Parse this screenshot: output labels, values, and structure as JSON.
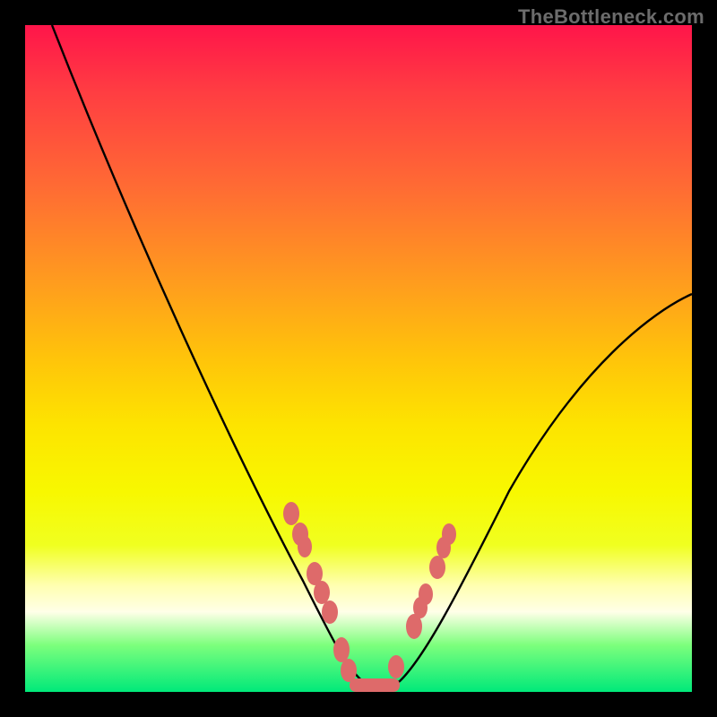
{
  "watermark": {
    "text": "TheBottleneck.com"
  },
  "chart_data": {
    "type": "line",
    "title": "",
    "xlabel": "",
    "ylabel": "",
    "xlim": [
      0,
      100
    ],
    "ylim": [
      0,
      100
    ],
    "series": [
      {
        "name": "curve",
        "x": [
          4,
          10,
          20,
          30,
          40,
          45,
          48,
          50,
          53,
          55,
          60,
          70,
          80,
          90,
          100
        ],
        "y": [
          100,
          87,
          69,
          50,
          28,
          14,
          5,
          1,
          0,
          4,
          14,
          30,
          42,
          52,
          60
        ]
      }
    ],
    "markers": [
      {
        "name": "left-dots",
        "color": "#de6a6a",
        "points": [
          {
            "x": 39.5,
            "y": 27
          },
          {
            "x": 40.8,
            "y": 24
          },
          {
            "x": 41.4,
            "y": 22
          },
          {
            "x": 43.0,
            "y": 18
          },
          {
            "x": 44.2,
            "y": 15
          },
          {
            "x": 45.3,
            "y": 12
          },
          {
            "x": 47.1,
            "y": 6
          },
          {
            "x": 48.2,
            "y": 3
          }
        ]
      },
      {
        "name": "bottom-bar",
        "color": "#de6a6a",
        "points": [
          {
            "x": 48.5,
            "y": 1
          },
          {
            "x": 49.5,
            "y": 0.6
          },
          {
            "x": 50.5,
            "y": 0.4
          },
          {
            "x": 51.5,
            "y": 0.4
          },
          {
            "x": 52.5,
            "y": 0.6
          },
          {
            "x": 53.5,
            "y": 1
          }
        ]
      },
      {
        "name": "right-dots",
        "color": "#de6a6a",
        "points": [
          {
            "x": 55.0,
            "y": 4
          },
          {
            "x": 57.6,
            "y": 10
          },
          {
            "x": 58.5,
            "y": 13
          },
          {
            "x": 59.3,
            "y": 15
          },
          {
            "x": 61.0,
            "y": 19
          },
          {
            "x": 62.0,
            "y": 22
          },
          {
            "x": 62.8,
            "y": 24
          }
        ]
      }
    ]
  }
}
